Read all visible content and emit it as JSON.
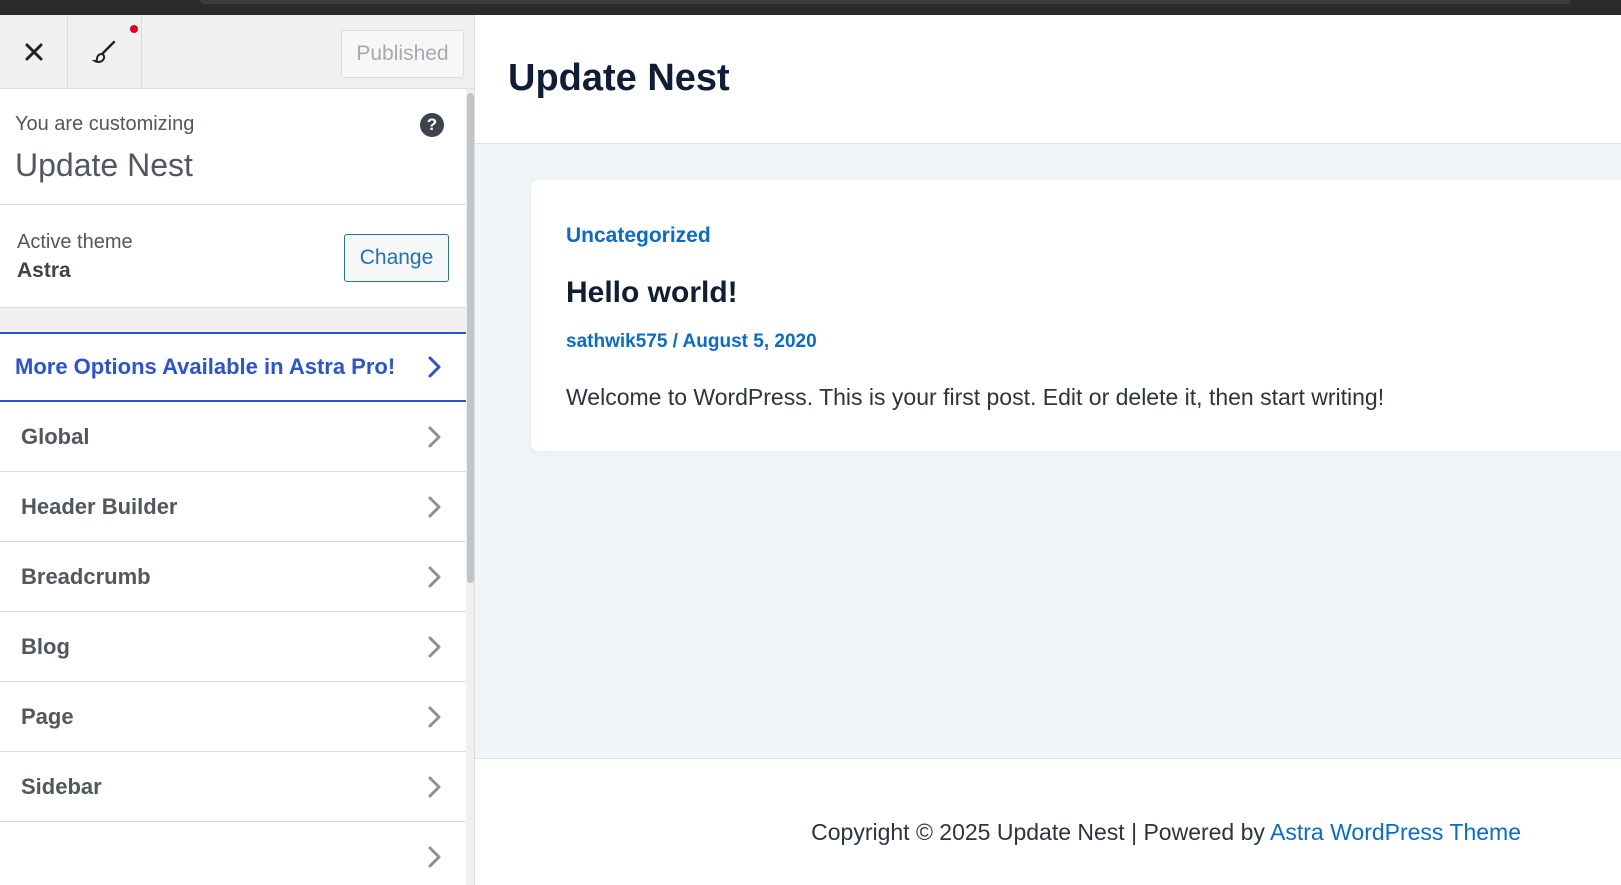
{
  "header": {
    "publish_label": "Published",
    "close_icon": "close-icon",
    "brush_icon": "paintbrush-icon"
  },
  "customizing": {
    "label": "You are customizing",
    "site_name": "Update Nest",
    "help_icon": "?"
  },
  "theme": {
    "label": "Active theme",
    "name": "Astra",
    "change_label": "Change"
  },
  "pro": {
    "label": "More Options Available in Astra Pro!"
  },
  "menu": {
    "items": [
      {
        "label": "Global"
      },
      {
        "label": "Header Builder"
      },
      {
        "label": "Breadcrumb"
      },
      {
        "label": "Blog"
      },
      {
        "label": "Page"
      },
      {
        "label": "Sidebar"
      }
    ]
  },
  "preview": {
    "site_title": "Update Nest",
    "post": {
      "category": "Uncategorized",
      "title": "Hello world!",
      "author": "sathwik575",
      "separator": " / ",
      "date": "August 5, 2020",
      "excerpt": "Welcome to WordPress. This is your first post. Edit or delete it, then start writing!"
    },
    "footer": {
      "text": "Copyright © 2025 Update Nest | Powered by ",
      "link": "Astra WordPress Theme"
    }
  },
  "colors": {
    "accent": "#2c52d7",
    "link": "#0a6bcf",
    "notification": "#e0001b"
  }
}
